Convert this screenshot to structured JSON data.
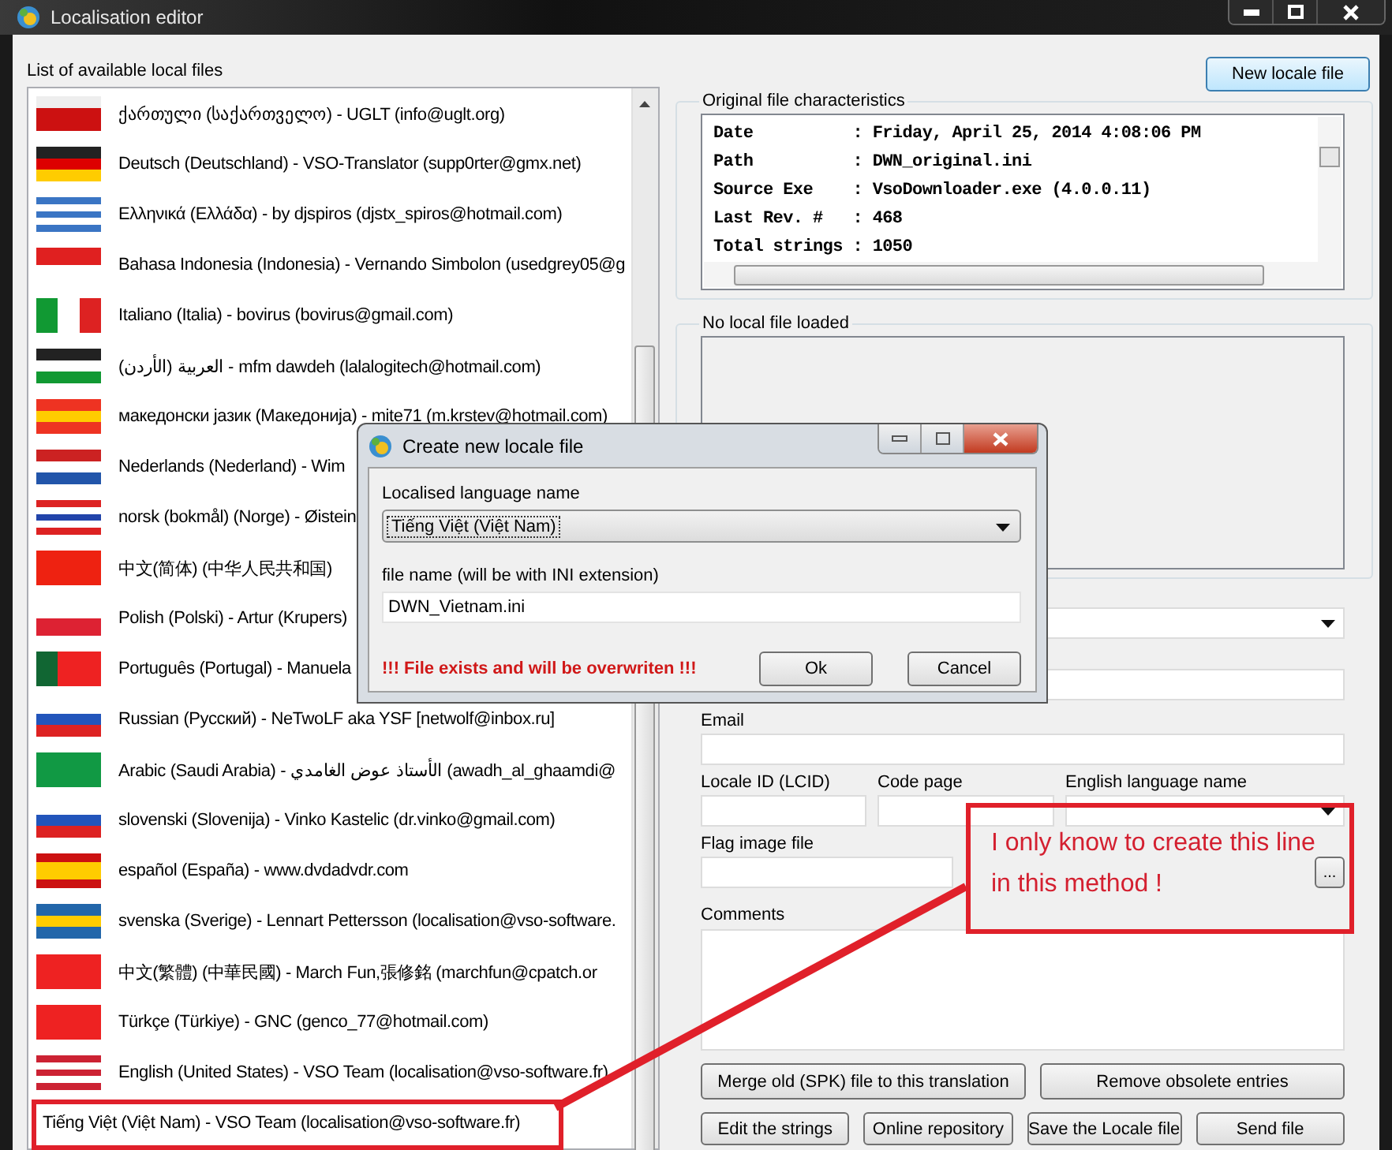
{
  "window": {
    "title": "Localisation editor"
  },
  "locale_list": {
    "label": "List of available local files",
    "items": [
      {
        "kind": "ge",
        "text": "ქართული (საქართველო) - UGLT (info@uglt.org)"
      },
      {
        "kind": "de",
        "text": "Deutsch (Deutschland) - VSO-Translator (supp0rter@gmx.net)"
      },
      {
        "kind": "gr",
        "text": "Ελληνικά (Ελλάδα) - by djspiros (djstx_spiros@hotmail.com)"
      },
      {
        "kind": "id",
        "text": "Bahasa Indonesia (Indonesia) - Vernando Simbolon (usedgrey05@g"
      },
      {
        "kind": "it",
        "text": "Italiano (Italia) - bovirus (bovirus@gmail.com)"
      },
      {
        "kind": "jo",
        "text": "العربية (الأردن) - mfm dawdeh (lalalogitech@hotmail.com)"
      },
      {
        "kind": "mk",
        "text": "македонски јазик (Македонија) - mite71 (m.krstev@hotmail.com)"
      },
      {
        "kind": "nl",
        "text": "Nederlands (Nederland) - Wim"
      },
      {
        "kind": "no",
        "text": "norsk (bokmål) (Norge) - Øistein"
      },
      {
        "kind": "cn",
        "text": "中文(简体) (中华人民共和国)"
      },
      {
        "kind": "pl",
        "text": "Polish (Polski) - Artur (Krupers)"
      },
      {
        "kind": "pt",
        "text": "Português (Portugal) - Manuela"
      },
      {
        "kind": "ru",
        "text": "Russian (Русский) - NeTwoLF aka YSF [netwolf@inbox.ru]"
      },
      {
        "kind": "sa",
        "text": "Arabic (Saudi Arabia) - الأستاذ عوض الغامدي (awadh_al_ghaamdi@"
      },
      {
        "kind": "si",
        "text": "slovenski (Slovenija) - Vinko Kastelic (dr.vinko@gmail.com)"
      },
      {
        "kind": "es",
        "text": "español (España) - www.dvdadvdr.com"
      },
      {
        "kind": "se",
        "text": "svenska (Sverige) - Lennart Pettersson (localisation@vso-software."
      },
      {
        "kind": "tw",
        "text": "中文(繁體) (中華民國) - March Fun,張修銘 (marchfun@cpatch.or"
      },
      {
        "kind": "tr",
        "text": "Türkçe (Türkiye) - GNC (genco_77@hotmail.com)"
      },
      {
        "kind": "us",
        "text": "English (United States) - VSO Team (localisation@vso-software.fr)"
      },
      {
        "text": "Tiếng Việt (Việt Nam) - VSO Team (localisation@vso-software.fr)"
      }
    ]
  },
  "new_locale_button": "New locale file",
  "original_file": {
    "title": "Original file characteristics",
    "lines": [
      "Date          : Friday, April 25, 2014 4:08:06 PM",
      "Path          : DWN_original.ini",
      "Source Exe    : VsoDownloader.exe (4.0.0.11)",
      "Last Rev. #   : 468",
      "Total strings : 1050"
    ]
  },
  "local_file": {
    "title": "No local file loaded"
  },
  "form": {
    "email_label": "Email",
    "lcid_label": "Locale ID (LCID)",
    "codepage_label": "Code page",
    "english_name_label": "English language name",
    "flag_label": "Flag image file",
    "browse_button": "...",
    "comments_label": "Comments"
  },
  "buttons": [
    "Merge old (SPK) file to this translation",
    "Remove obsolete entries",
    "Edit the strings",
    "Online repository",
    "Save the Locale file",
    "Send file"
  ],
  "dialog": {
    "title": "Create new locale file",
    "language_label": "Localised language name",
    "language_value": "Tiếng Việt (Việt Nam)",
    "filename_label": "file name (will be with INI extension)",
    "filename_value": "DWN_Vietnam.ini",
    "warning": "!!! File exists and will be overwriten !!!",
    "buttons": [
      "Ok",
      "Cancel"
    ]
  },
  "annotation": {
    "text": "I only know to create this line in this method !"
  }
}
